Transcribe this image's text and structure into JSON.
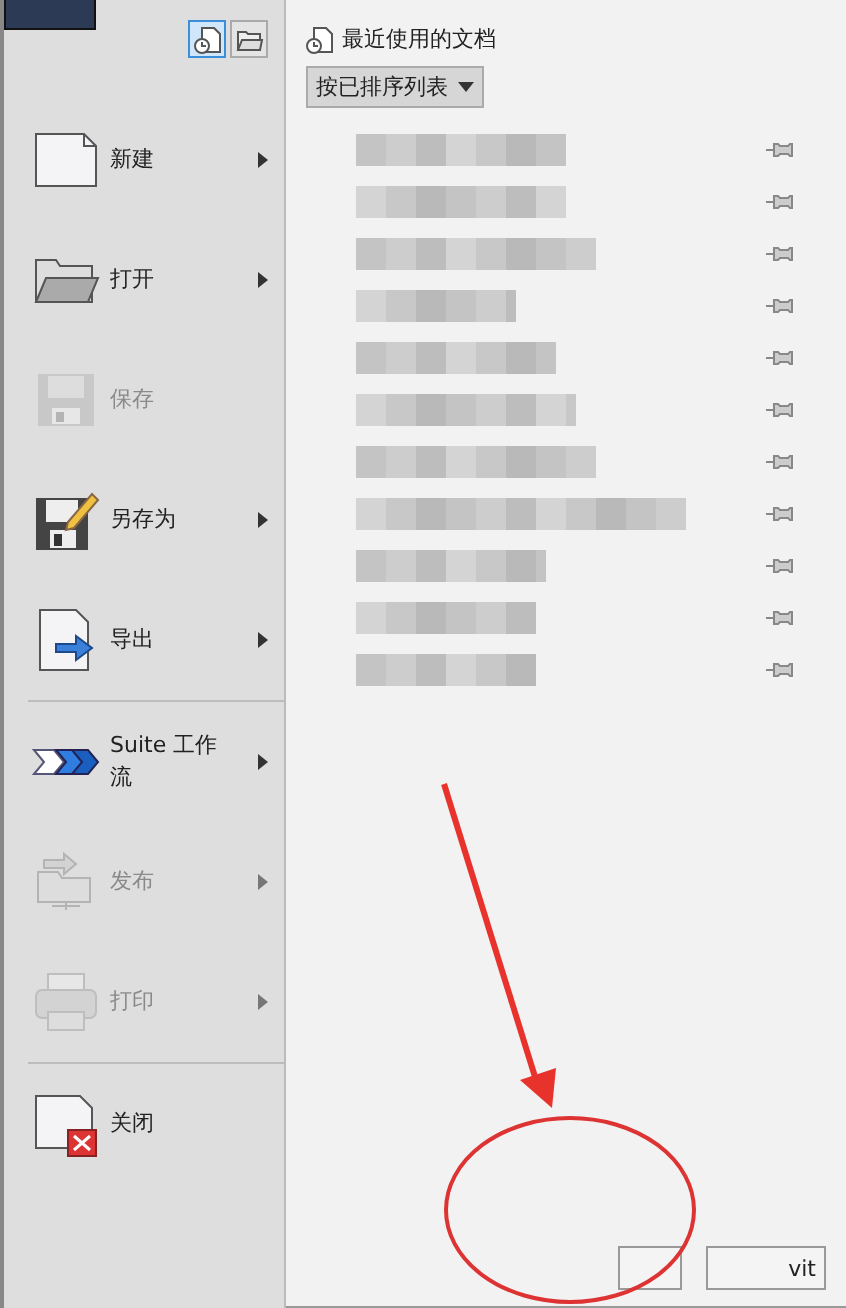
{
  "view_toggle": [
    {
      "kind": "recent",
      "selected": true
    },
    {
      "kind": "open",
      "selected": false
    }
  ],
  "menu": [
    {
      "kind": "new",
      "label": "新建",
      "disabled": false,
      "submenu": true
    },
    {
      "kind": "open",
      "label": "打开",
      "disabled": false,
      "submenu": true
    },
    {
      "kind": "save",
      "label": "保存",
      "disabled": true,
      "submenu": false
    },
    {
      "kind": "saveas",
      "label": "另存为",
      "disabled": false,
      "submenu": true
    },
    {
      "kind": "export",
      "label": "导出",
      "disabled": false,
      "submenu": true
    },
    {
      "kind": "separator"
    },
    {
      "kind": "suite",
      "label": "Suite 工作流",
      "disabled": false,
      "submenu": true
    },
    {
      "kind": "publish",
      "label": "发布",
      "disabled": true,
      "submenu": true
    },
    {
      "kind": "print",
      "label": "打印",
      "disabled": true,
      "submenu": true
    },
    {
      "kind": "separator"
    },
    {
      "kind": "close",
      "label": "关闭",
      "disabled": false,
      "submenu": false
    }
  ],
  "recent": {
    "title": "最近使用的文档",
    "sort": "按已排序列表",
    "files": [
      {
        "kind": "blurred"
      },
      {
        "kind": "blurred"
      },
      {
        "kind": "blurred"
      },
      {
        "kind": "blurred"
      },
      {
        "kind": "blurred"
      },
      {
        "kind": "blurred"
      },
      {
        "kind": "blurred"
      },
      {
        "kind": "blurred"
      },
      {
        "kind": "blurred"
      },
      {
        "kind": "blurred"
      },
      {
        "kind": "blurred"
      }
    ]
  },
  "footer_button": "vit"
}
